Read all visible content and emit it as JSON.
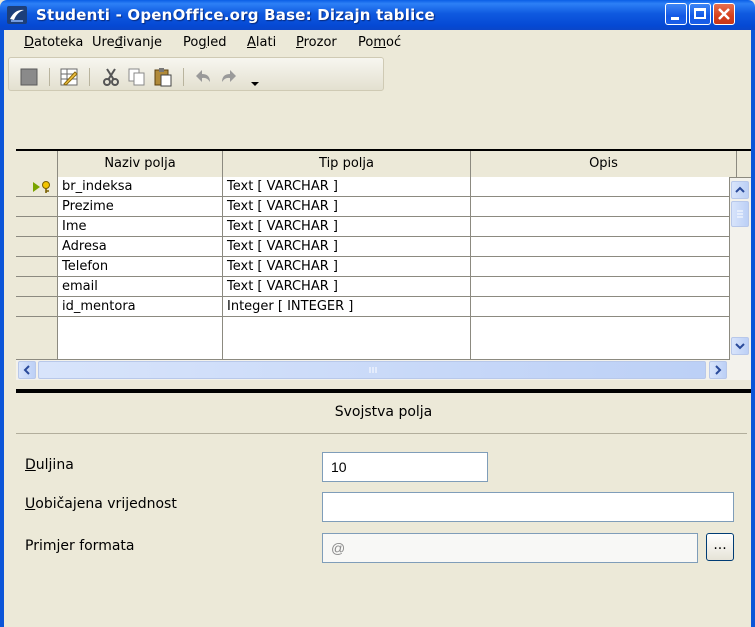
{
  "window": {
    "title": "Studenti - OpenOffice.org Base: Dizajn tablice"
  },
  "menu": [
    {
      "label": "Datoteka",
      "u": "D",
      "rest": "atoteka"
    },
    {
      "label": "Uređivanje",
      "pre": "Ure",
      "u": "đ",
      "rest": "ivanje"
    },
    {
      "label": "Pogled",
      "pre": "Po",
      "u": "g",
      "rest": "led"
    },
    {
      "label": "Alati",
      "u": "A",
      "rest": "lati"
    },
    {
      "label": "Prozor",
      "u": "P",
      "rest": "rozor"
    },
    {
      "label": "Pomoć",
      "pre": "Po",
      "u": "m",
      "rest": "oć"
    }
  ],
  "toolbar": {
    "icons": [
      "save-icon",
      "table-design-icon",
      "cut-icon",
      "copy-icon",
      "paste-icon",
      "undo-icon",
      "redo-icon",
      "toolbar-more-icon"
    ]
  },
  "grid": {
    "headers": {
      "name": "Naziv polja",
      "type": "Tip polja",
      "desc": "Opis"
    },
    "rows": [
      {
        "name": "br_indeksa",
        "type": "Text [ VARCHAR ]",
        "desc": "",
        "primary_key": true
      },
      {
        "name": "Prezime",
        "type": "Text [ VARCHAR ]",
        "desc": ""
      },
      {
        "name": "Ime",
        "type": "Text [ VARCHAR ]",
        "desc": ""
      },
      {
        "name": "Adresa",
        "type": "Text [ VARCHAR ]",
        "desc": ""
      },
      {
        "name": "Telefon",
        "type": "Text [ VARCHAR ]",
        "desc": ""
      },
      {
        "name": "email",
        "type": "Text [ VARCHAR ]",
        "desc": ""
      },
      {
        "name": "id_mentora",
        "type": "Integer [ INTEGER ]",
        "desc": ""
      },
      {
        "name": "",
        "type": "",
        "desc": ""
      }
    ]
  },
  "properties": {
    "title": "Svojstva polja",
    "length_label": "Duljina",
    "length_value": "10",
    "default_label": "Uobičajena vrijednost",
    "default_value": "",
    "format_label": "Primjer formata",
    "format_value": "@",
    "format_button": "..."
  },
  "colors": {
    "titlebar": "#0a58e0",
    "frame": "#0b55d8",
    "chrome": "#ece9d8",
    "close": "#d5401c"
  }
}
